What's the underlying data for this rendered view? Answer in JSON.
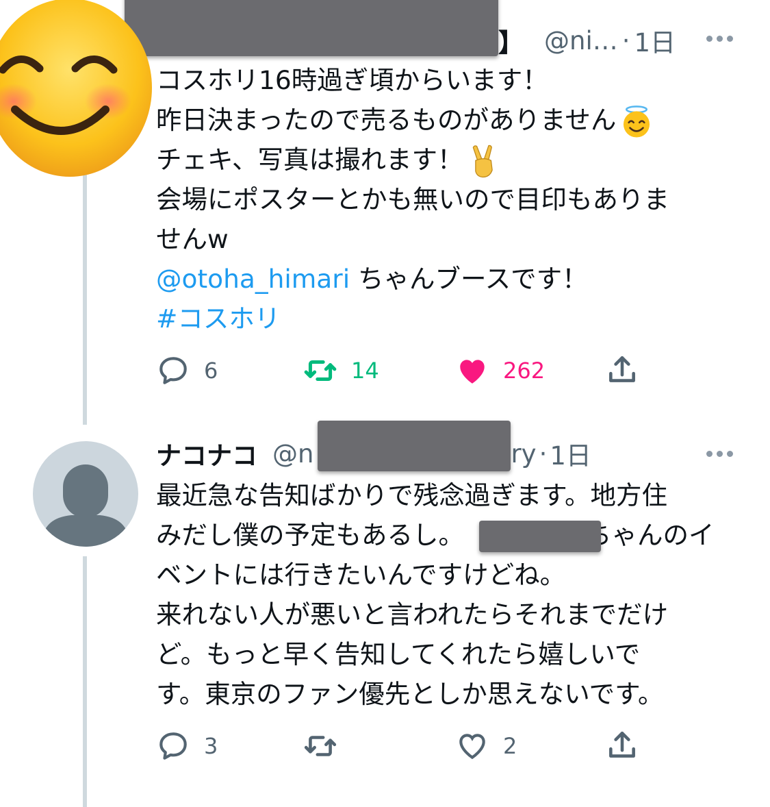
{
  "tweet1": {
    "name_tail": "】",
    "handle": "@ni…",
    "dot": "·",
    "time": "1日",
    "body_lines": [
      "コスホリ16時過ぎ頃からいます！",
      "昨日決まったので売るものがありません",
      "チェキ、写真は撮れます！",
      "会場にポスターとかも無いので目印もありま",
      "せんw"
    ],
    "mention": "@otoha_himari",
    "mention_suffix": " ちゃんブースです！",
    "hashtag": "#コスホリ",
    "stats": {
      "replies": "6",
      "retweets": "14",
      "likes": "262"
    },
    "colors": {
      "retweet": "#00ba7c",
      "like": "#f91880"
    }
  },
  "tweet2": {
    "name": "ナコナコ",
    "handle_start": "@n",
    "handle_end": "ry",
    "dot": "·",
    "time": "1日",
    "body_lines": [
      "最近急な告知ばかりで残念過ぎます。地方住",
      "みだし僕の予定もあるし。",
      "ちゃんのイ",
      "ベントには行きたいんですけどね。",
      "来れない人が悪いと言われたらそれまでだけ",
      "ど。もっと早く告知してくれたら嬉しいで",
      "す。東京のファン優先としか思えないです。"
    ],
    "stats": {
      "replies": "3",
      "retweets": "",
      "likes": "2"
    }
  },
  "icons": {
    "avatar1": "smiling-face-emoji-icon",
    "avatar2": "default-profile-icon",
    "halo": "smiling-face-with-halo-icon",
    "victory": "victory-hand-icon",
    "reply": "reply-icon",
    "retweet": "retweet-icon",
    "like": "heart-icon",
    "share": "share-icon",
    "more": "more-options-icon"
  }
}
